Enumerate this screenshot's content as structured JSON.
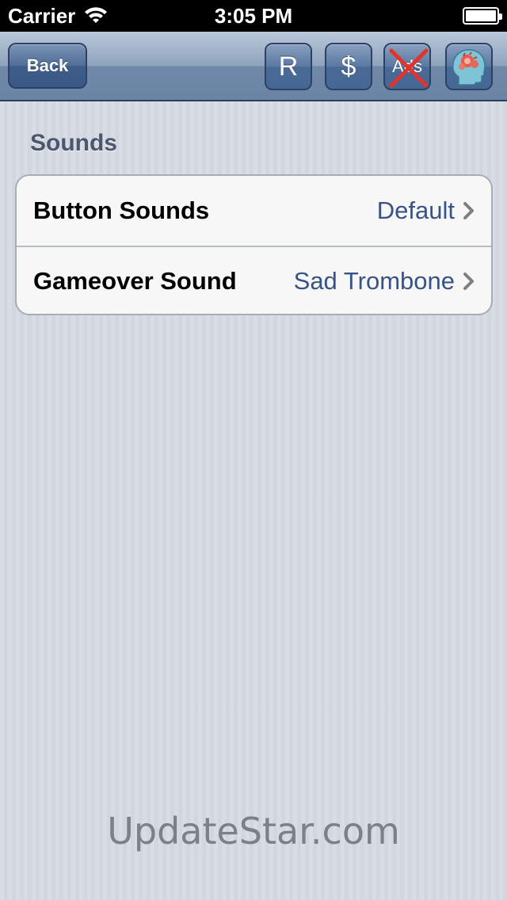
{
  "status_bar": {
    "carrier": "Carrier",
    "time": "3:05 PM",
    "battery_level": 1.0
  },
  "nav_bar": {
    "back_label": "Back",
    "buttons": [
      {
        "label": "R"
      },
      {
        "label": "$"
      },
      {
        "label": "Ads",
        "icon": "no-ads-icon"
      },
      {
        "icon": "avatar-icon"
      }
    ]
  },
  "section": {
    "title": "Sounds",
    "rows": [
      {
        "label": "Button Sounds",
        "value": "Default"
      },
      {
        "label": "Gameover Sound",
        "value": "Sad Trombone"
      }
    ]
  },
  "watermark": "UpdateStar.com",
  "colors": {
    "nav_bar": "#7b93b3",
    "cell_value": "#385487",
    "section_title": "#4c566c",
    "background": "#d3d8e2"
  }
}
